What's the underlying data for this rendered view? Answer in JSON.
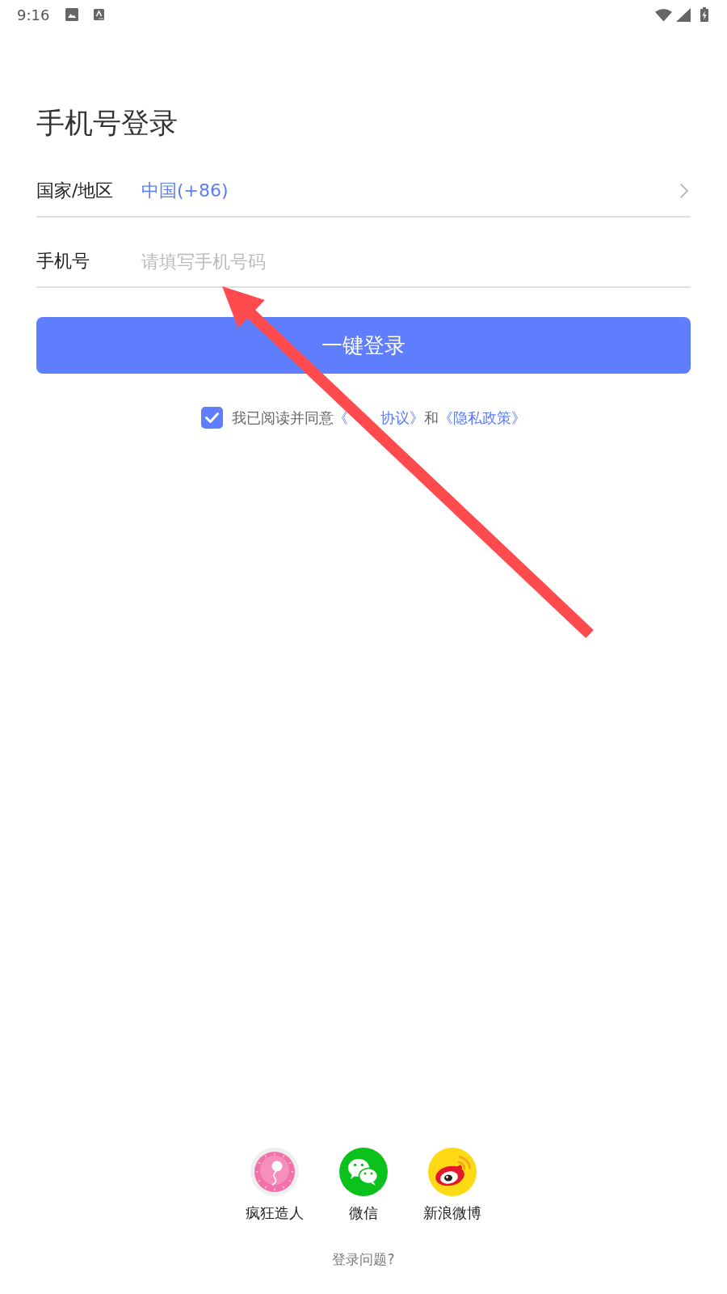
{
  "status_bar": {
    "time": "9:16"
  },
  "title": "手机号登录",
  "fields": [
    {
      "kind": "select",
      "label": "国家/地区",
      "value": "中国(+86)"
    },
    {
      "kind": "input",
      "label": "手机号",
      "placeholder": "请填写手机号码"
    }
  ],
  "login_button": {
    "label": "一键登录"
  },
  "agreement": {
    "checked": true,
    "parts": [
      {
        "kind": "text",
        "text": "我已阅读并同意"
      },
      {
        "kind": "link",
        "text": "《"
      },
      {
        "kind": "covered"
      },
      {
        "kind": "link",
        "text": "协议》"
      },
      {
        "kind": "text",
        "text": "和"
      },
      {
        "kind": "link",
        "text": "《隐私政策》"
      }
    ]
  },
  "third_party": [
    {
      "kind": "app",
      "label": "疯狂造人"
    },
    {
      "kind": "wechat",
      "label": "微信"
    },
    {
      "kind": "weibo",
      "label": "新浪微博"
    }
  ],
  "help_link": "登录问题?"
}
